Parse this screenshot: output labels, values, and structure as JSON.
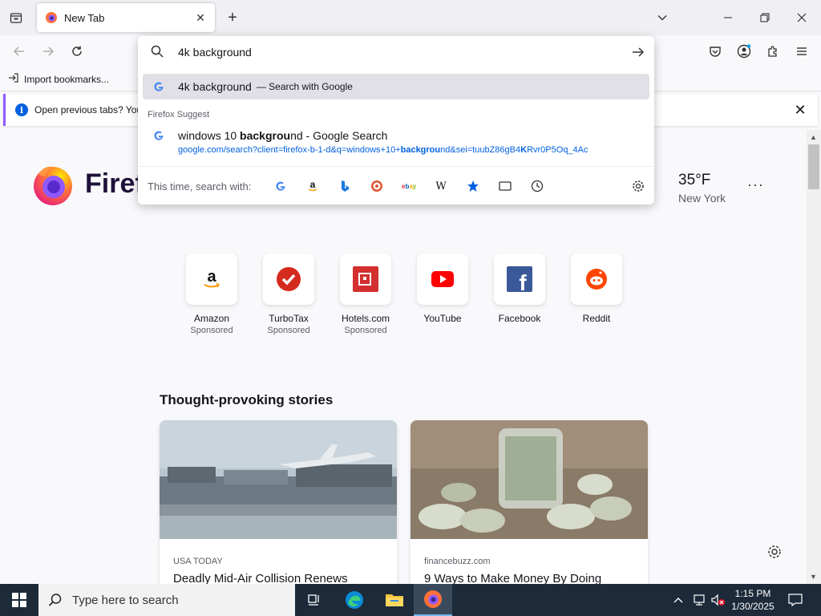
{
  "tab": {
    "title": "New Tab"
  },
  "bookmarks": {
    "import_label": "Import bookmarks..."
  },
  "notification": {
    "text": "Open previous tabs? You"
  },
  "urlbar": {
    "query": "4k background",
    "selected": {
      "text": "4k background",
      "suffix": "— Search with Google"
    },
    "section_label": "Firefox Suggest",
    "suggestion": {
      "title_pre": "windows 10 ",
      "title_bold": "backgrou",
      "title_post": "nd - Google Search",
      "url_pre": "google.com/search?client=firefox-b-1-d&q=windows+10+",
      "url_bold": "backgrou",
      "url_mid": "nd&sei=tuubZ86gB4",
      "url_bold2": "K",
      "url_post": "Rvr0P5Oq_4Ac"
    },
    "engines_label": "This time, search with:"
  },
  "page": {
    "logo_word": "Firef",
    "weather": {
      "temp": "35°F",
      "city": "New York",
      "more": "···"
    },
    "tiles": [
      {
        "name": "Amazon",
        "sponsored": "Sponsored"
      },
      {
        "name": "TurboTax",
        "sponsored": "Sponsored"
      },
      {
        "name": "Hotels.com",
        "sponsored": "Sponsored"
      },
      {
        "name": "YouTube",
        "sponsored": ""
      },
      {
        "name": "Facebook",
        "sponsored": ""
      },
      {
        "name": "Reddit",
        "sponsored": ""
      }
    ],
    "stories_title": "Thought-provoking stories",
    "stories": [
      {
        "source": "USA TODAY",
        "headline": "Deadly Mid-Air Collision Renews"
      },
      {
        "source": "financebuzz.com",
        "headline": "9 Ways to Make Money By Doing"
      }
    ]
  },
  "taskbar": {
    "search_placeholder": "Type here to search",
    "time": "1:15 PM",
    "date": "1/30/2025"
  }
}
